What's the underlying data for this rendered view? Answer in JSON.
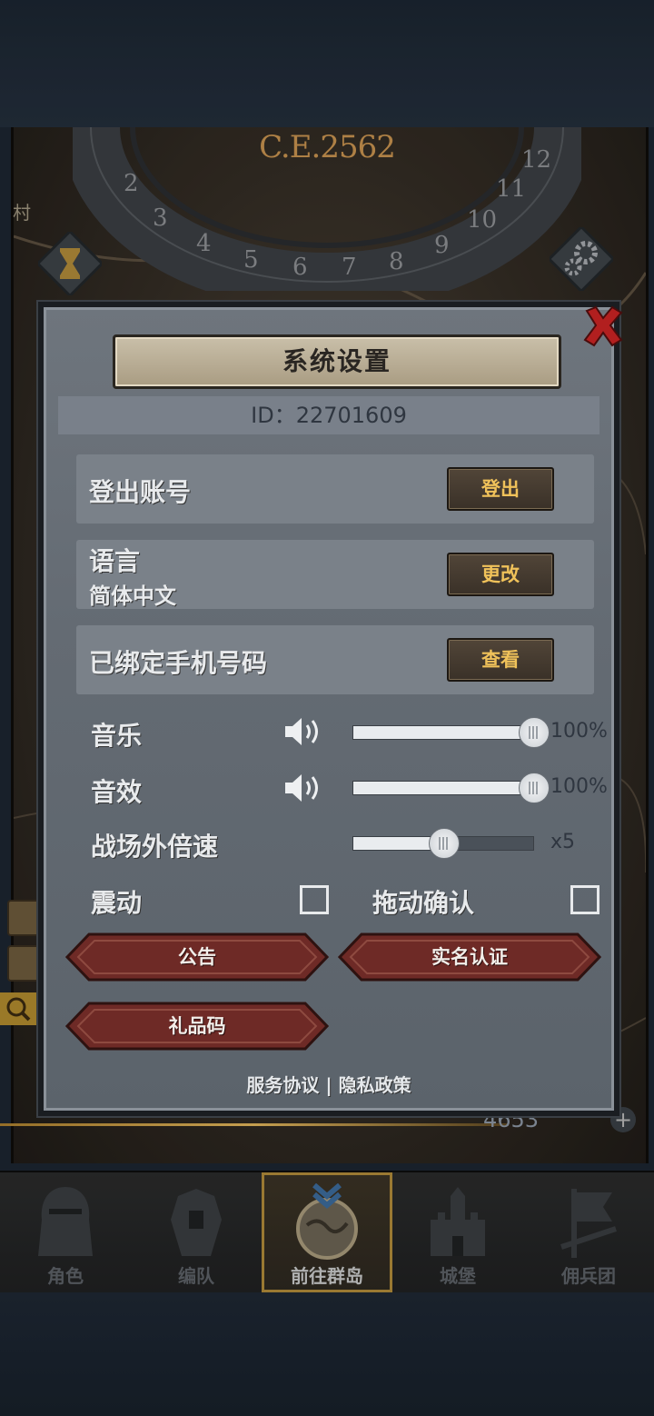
{
  "scene": {
    "era": "C.E.2562",
    "village_label": "村",
    "resource_count": "4653",
    "dial_numbers": [
      "2",
      "3",
      "4",
      "5",
      "6",
      "7",
      "8",
      "9",
      "10",
      "11",
      "12"
    ]
  },
  "dialog": {
    "title": "系统设置",
    "id_label": "ID：",
    "id_value": "22701609",
    "logout": {
      "label": "登出账号",
      "button": "登出"
    },
    "language": {
      "label": "语言",
      "current": "简体中文",
      "button": "更改"
    },
    "phone": {
      "label": "已绑定手机号码",
      "button": "查看"
    },
    "music": {
      "label": "音乐",
      "value_text": "100%",
      "level": 1.0
    },
    "sfx": {
      "label": "音效",
      "value_text": "100%",
      "level": 1.0
    },
    "speed": {
      "label": "战场外倍速",
      "value_text": "x5",
      "level": 0.5
    },
    "vibration": {
      "label": "震动",
      "checked": false
    },
    "drag_confirm": {
      "label": "拖动确认",
      "checked": false
    },
    "announcement_button": "公告",
    "realname_button": "实名认证",
    "giftcode_button": "礼品码",
    "terms_link": "服务协议",
    "separator": "|",
    "privacy_link": "隐私政策"
  },
  "bottom_nav": {
    "tabs": [
      {
        "label": "角色",
        "icon": "knight-helmet-icon",
        "active": false
      },
      {
        "label": "编队",
        "icon": "armor-icon",
        "active": false
      },
      {
        "label": "前往群岛",
        "icon": "globe-icon",
        "active": true
      },
      {
        "label": "城堡",
        "icon": "castle-icon",
        "active": false
      },
      {
        "label": "佣兵团",
        "icon": "mercenary-flag-icon",
        "active": false
      }
    ]
  },
  "colors": {
    "accent_gold": "#b08a3a",
    "button_text": "#f0c25a",
    "red_button": "#6e2a26",
    "panel": "#646b73"
  }
}
